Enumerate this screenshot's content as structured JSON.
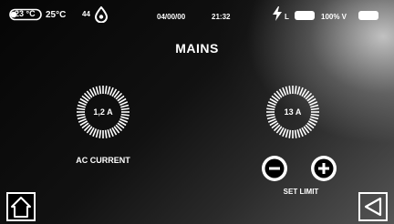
{
  "status_bar": {
    "probe_temp": "23 °C",
    "ambient_temp": "25°C",
    "humidity": "44",
    "humidity_icon": "droplet-icon",
    "date": "04/00/00",
    "time": "21:32",
    "power_icon": "lightning-bolt-icon",
    "battery_label": "L",
    "battery_percent": "100% V"
  },
  "title": "MAINS",
  "gauges": {
    "ac_current": {
      "value": "1,2 A",
      "label": "AC CURRENT"
    },
    "set_limit": {
      "value": "13 A",
      "label": "SET LIMIT"
    }
  },
  "buttons": {
    "decrease_icon": "minus-icon",
    "increase_icon": "plus-icon",
    "home_icon": "home-icon",
    "back_icon": "back-triangle-icon"
  },
  "colors": {
    "foreground": "#ffffff",
    "background": "#000000"
  }
}
